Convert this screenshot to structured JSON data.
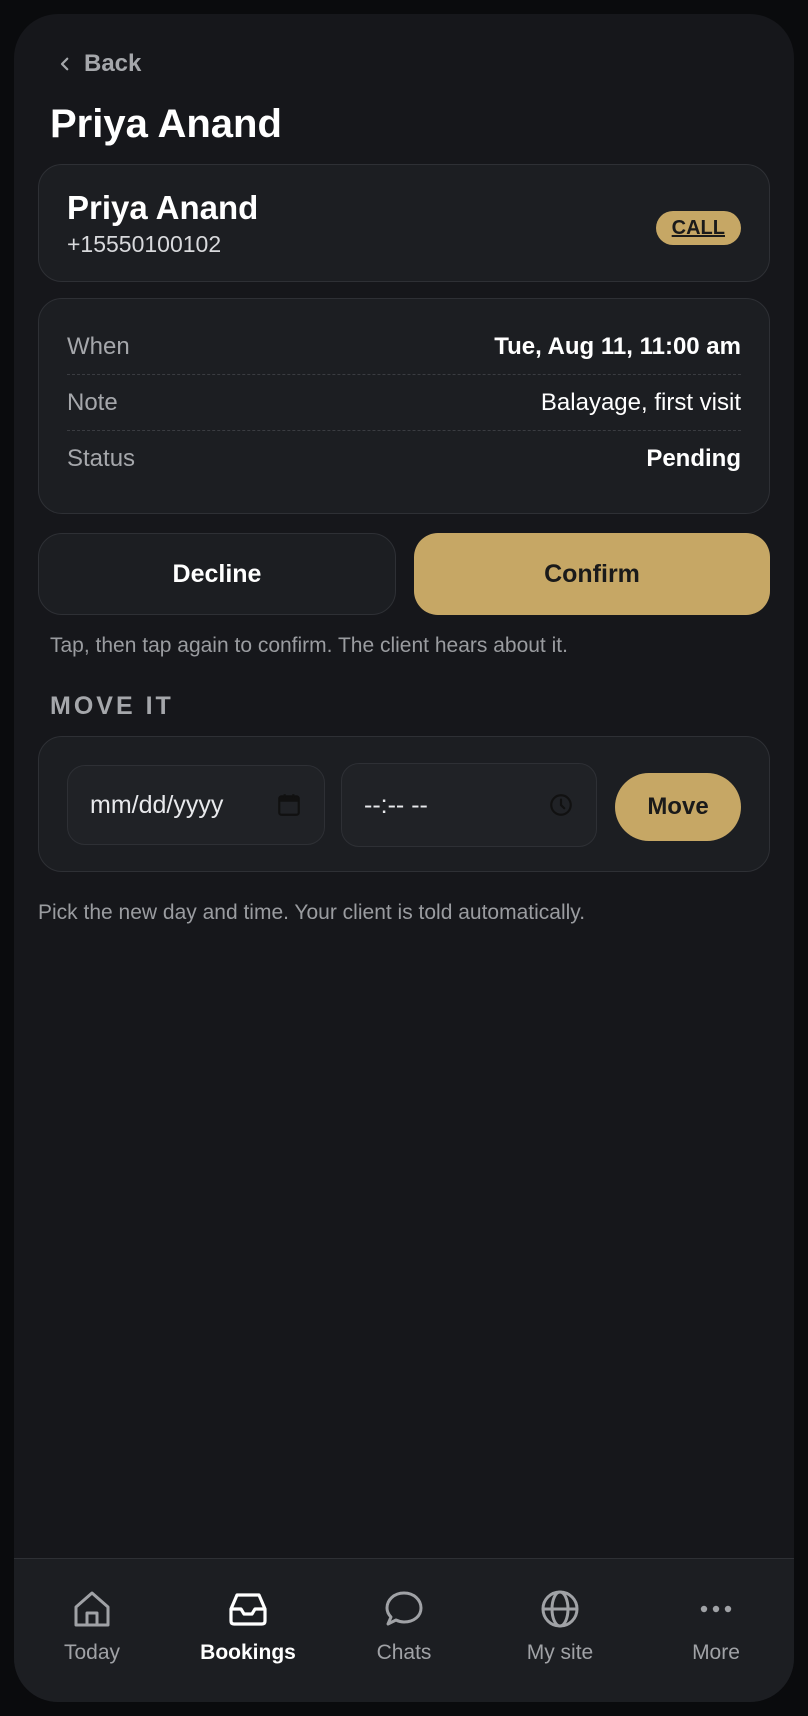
{
  "header": {
    "back_label": "Back",
    "title": "Priya Anand"
  },
  "client": {
    "name": "Priya Anand",
    "phone": "+15550100102",
    "call_label": "CALL"
  },
  "details": [
    {
      "label": "When",
      "value": "Tue, Aug 11, 11:00 am",
      "bold": true
    },
    {
      "label": "Note",
      "value": "Balayage, first visit",
      "bold": false
    },
    {
      "label": "Status",
      "value": "Pending",
      "bold": true
    }
  ],
  "actions": {
    "decline_label": "Decline",
    "confirm_label": "Confirm",
    "hint": "Tap, then tap again to confirm. The client hears about it."
  },
  "move": {
    "section_title": "MOVE IT",
    "date_placeholder": "mm/dd/yyyy",
    "time_placeholder": "--:-- --",
    "button_label": "Move",
    "hint": "Pick the new day and time. Your client is told automatically."
  },
  "tabs": [
    {
      "label": "Today",
      "icon": "home-icon",
      "active": false
    },
    {
      "label": "Bookings",
      "icon": "inbox-icon",
      "active": true
    },
    {
      "label": "Chats",
      "icon": "chat-bubble-icon",
      "active": false
    },
    {
      "label": "My site",
      "icon": "globe-icon",
      "active": false
    },
    {
      "label": "More",
      "icon": "more-dots-icon",
      "active": false
    }
  ],
  "colors": {
    "accent": "#c6a765",
    "background": "#16171b",
    "card": "#1c1e22"
  }
}
